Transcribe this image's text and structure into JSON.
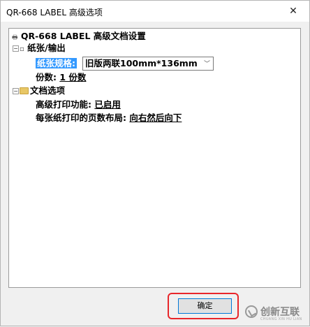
{
  "window": {
    "title": "QR-668 LABEL 高级选项",
    "close_glyph": "✕"
  },
  "tree": {
    "root": {
      "label": "QR-668 LABEL 高级文档设置",
      "icon": "printer-icon"
    },
    "paper_output": {
      "label": "纸张/输出",
      "icon": "paper-icon",
      "paper_size_label": "纸张规格:",
      "paper_size_value": "旧版两联100mm*136mm",
      "copies_label": "份数:",
      "copies_value": "1 份数"
    },
    "doc_options": {
      "label": "文档选项",
      "icon": "folder-icon",
      "advanced_print_label": "高级打印功能:",
      "advanced_print_value": "已启用",
      "pages_per_sheet_label": "每张纸打印的页数布局:",
      "pages_per_sheet_value": "向右然后向下"
    }
  },
  "buttons": {
    "ok_label": "确定"
  },
  "watermark": {
    "text": "创新互联",
    "subtext": "CHUANG XIN HU LIAN"
  },
  "colors": {
    "selection": "#3399ff",
    "highlight_box": "#e8262a",
    "ok_border": "#0078d7"
  }
}
